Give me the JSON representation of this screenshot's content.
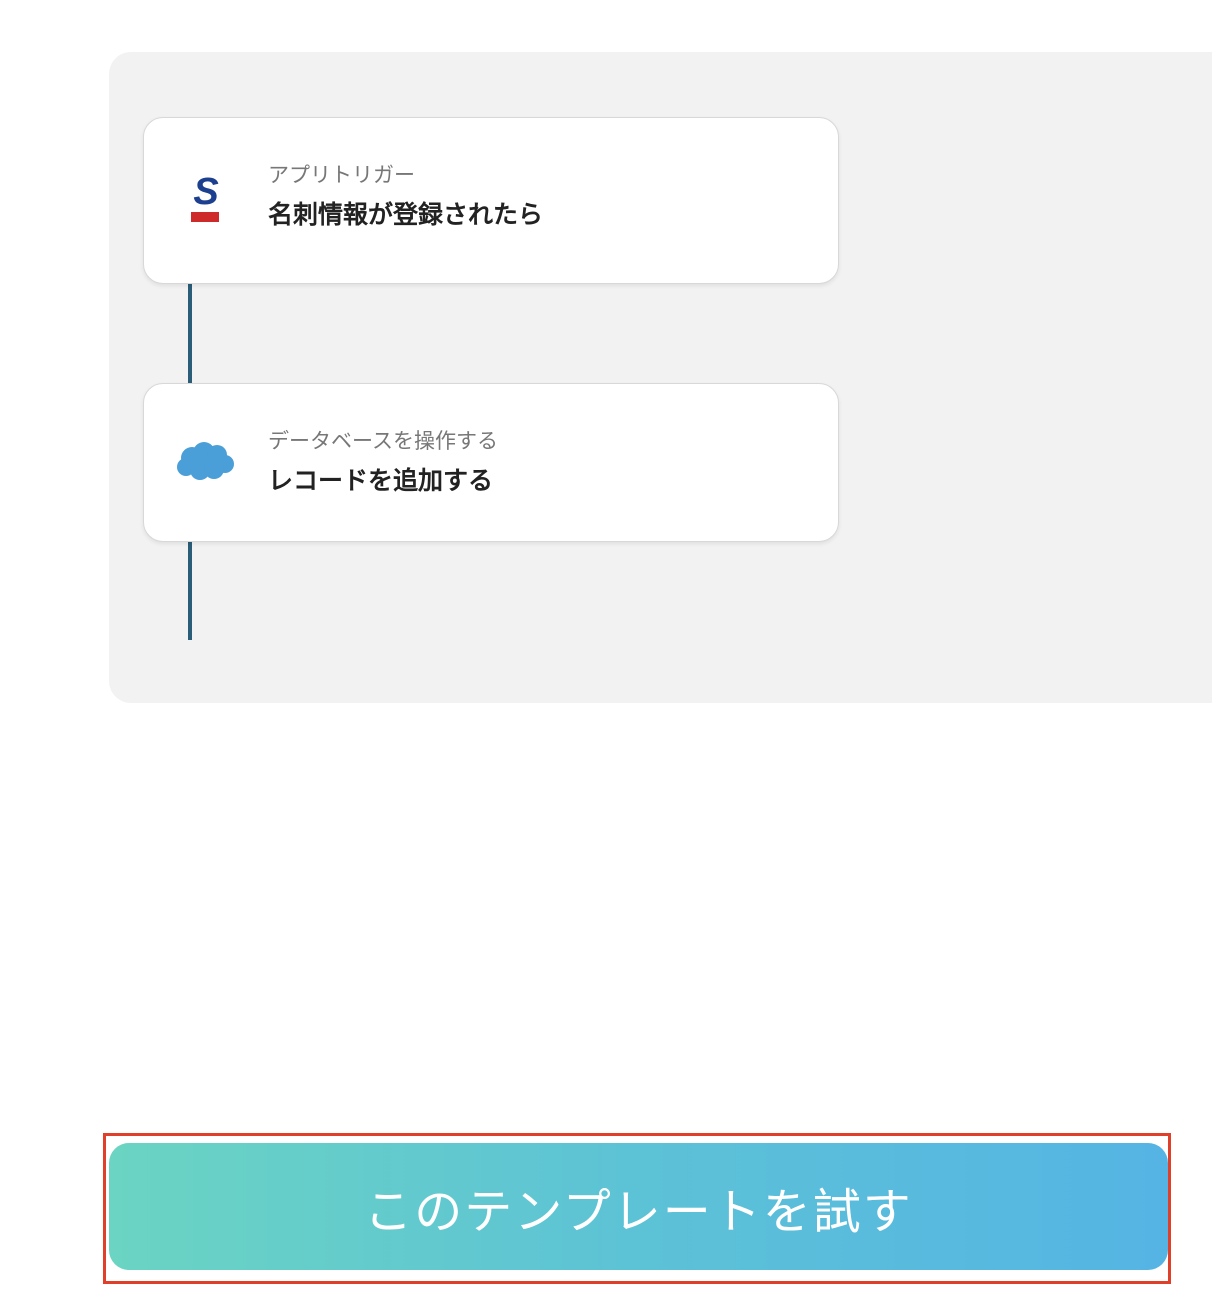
{
  "flow": {
    "steps": [
      {
        "icon": "sansan-logo-icon",
        "subtitle": "アプリトリガー",
        "title": "名刺情報が登録されたら"
      },
      {
        "icon": "salesforce-cloud-icon",
        "subtitle": "データベースを操作する",
        "title": "レコードを追加する"
      }
    ]
  },
  "cta": {
    "label": "このテンプレートを試す"
  },
  "colors": {
    "connector": "#2a5d78",
    "highlight_border": "#e0402a",
    "gradient_start": "#6bd4c2",
    "gradient_end": "#55b4e4",
    "sansan_blue": "#1d3f8f",
    "sansan_red": "#cf2a2a",
    "salesforce_blue": "#4a9fd8"
  }
}
